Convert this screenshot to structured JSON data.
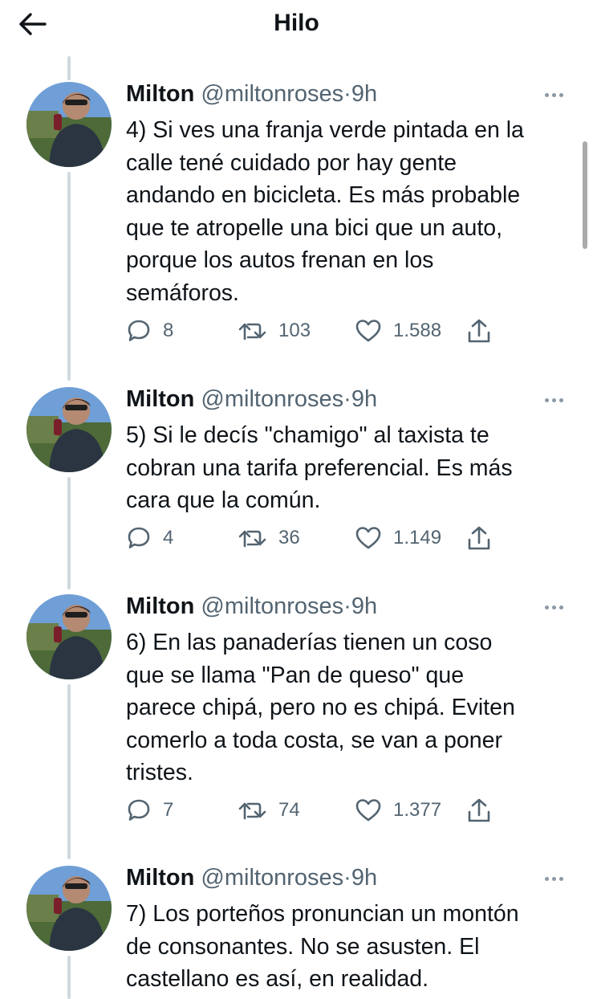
{
  "header": {
    "title": "Hilo"
  },
  "tweets": [
    {
      "name": "Milton",
      "handle": "@miltonroses",
      "separator": "·",
      "time": "9h",
      "text": "4) Si ves una franja verde pintada en la\ncalle tené cuidado por hay gente\nandando en bicicleta. Es más probable\nque te atropelle una bici que un auto,\nporque los autos frenan en los\nsemáforos.",
      "replies": "8",
      "retweets": "103",
      "likes": "1.588"
    },
    {
      "name": "Milton",
      "handle": "@miltonroses",
      "separator": "·",
      "time": "9h",
      "text": "5) Si le decís \"chamigo\" al taxista te\ncobran una tarifa preferencial. Es más\ncara que la común.",
      "replies": "4",
      "retweets": "36",
      "likes": "1.149"
    },
    {
      "name": "Milton",
      "handle": "@miltonroses",
      "separator": "·",
      "time": "9h",
      "text": "6) En las panaderías tienen un coso\nque se llama \"Pan de queso\" que\nparece chipá, pero no es chipá. Eviten\ncomerlo a toda costa, se van a poner\ntristes.",
      "replies": "7",
      "retweets": "74",
      "likes": "1.377"
    },
    {
      "name": "Milton",
      "handle": "@miltonroses",
      "separator": "·",
      "time": "9h",
      "text": "7) Los porteños pronuncian un montón\nde consonantes. No se asusten. El\ncastellano es así, en realidad."
    }
  ]
}
